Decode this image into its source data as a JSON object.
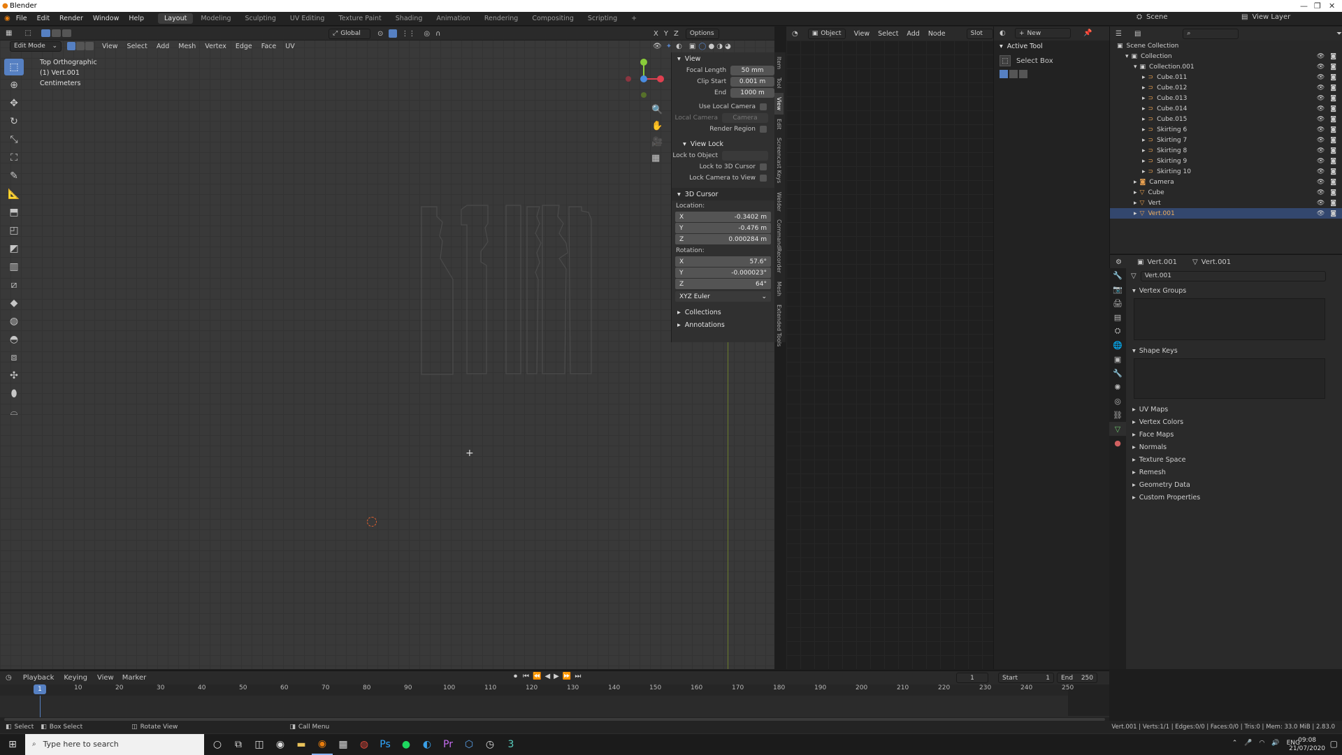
{
  "window": {
    "title": "Blender"
  },
  "menu": [
    "File",
    "Edit",
    "Render",
    "Window",
    "Help"
  ],
  "workspaces": [
    "Layout",
    "Modeling",
    "Sculpting",
    "UV Editing",
    "Texture Paint",
    "Shading",
    "Animation",
    "Rendering",
    "Compositing",
    "Scripting",
    "+"
  ],
  "active_workspace": "Layout",
  "scene": {
    "name": "Scene",
    "view_layer": "View Layer"
  },
  "viewport": {
    "mode": "Edit Mode",
    "menus": [
      "View",
      "Select",
      "Add",
      "Mesh",
      "Vertex",
      "Edge",
      "Face",
      "UV"
    ],
    "orientation": "Global",
    "options": "Options",
    "info": [
      "Top Orthographic",
      "(1) Vert.001",
      "Centimeters"
    ]
  },
  "npanel": {
    "view_title": "View",
    "focal_length": {
      "label": "Focal Length",
      "value": "50 mm"
    },
    "clip_start": {
      "label": "Clip Start",
      "value": "0.001 m"
    },
    "clip_end": {
      "label": "End",
      "value": "1000 m"
    },
    "use_local_camera": "Use Local Camera",
    "local_camera": "Local Camera",
    "camera_field": "Camera",
    "render_region": "Render Region",
    "view_lock_title": "View Lock",
    "lock_to_object": "Lock to Object",
    "lock_to_3d_cursor": "Lock to 3D Cursor",
    "lock_camera_to_view": "Lock Camera to View",
    "cursor_title": "3D Cursor",
    "location_label": "Location:",
    "location": [
      {
        "axis": "X",
        "value": "-0.3402 m"
      },
      {
        "axis": "Y",
        "value": "-0.476 m"
      },
      {
        "axis": "Z",
        "value": "0.000284 m"
      }
    ],
    "rotation_label": "Rotation:",
    "rotation": [
      {
        "axis": "X",
        "value": "57.6°"
      },
      {
        "axis": "Y",
        "value": "-0.000023°"
      },
      {
        "axis": "Z",
        "value": "64°"
      }
    ],
    "rotation_mode": "XYZ Euler",
    "collections": "Collections",
    "annotations": "Annotations",
    "tabs": [
      "Item",
      "Tool",
      "View",
      "Edit",
      "Screencast Keys",
      "Welder",
      "CommandRecorder",
      "Mesh",
      "Extended Tools"
    ]
  },
  "node_editor": {
    "object": "Object",
    "menus": [
      "View",
      "Select",
      "Add",
      "Node"
    ],
    "slot": "Slot",
    "new": "New"
  },
  "active_tool": {
    "title": "Active Tool",
    "name": "Select Box"
  },
  "outliner": {
    "root": "Scene Collection",
    "collection": "Collection",
    "collection_001": "Collection.001",
    "items": [
      "Cube.011",
      "Cube.012",
      "Cube.013",
      "Cube.014",
      "Cube.015",
      "Skirting 6",
      "Skirting 7",
      "Skirting 8",
      "Skirting 9",
      "Skirting 10"
    ],
    "top_items": [
      "Camera",
      "Cube",
      "Vert",
      "Vert.001"
    ]
  },
  "properties": {
    "object": "Vert.001",
    "mesh": "Vert.001",
    "mesh_field": "Vert.001",
    "sections_open": [
      "Vertex Groups",
      "Shape Keys"
    ],
    "sections": [
      "UV Maps",
      "Vertex Colors",
      "Face Maps",
      "Normals",
      "Texture Space",
      "Remesh",
      "Geometry Data",
      "Custom Properties"
    ]
  },
  "timeline": {
    "menus": [
      "Playback",
      "Keying",
      "View",
      "Marker"
    ],
    "current_frame": "1",
    "start_label": "Start",
    "start": "1",
    "end_label": "End",
    "end": "250",
    "ticks": [
      "1",
      "10",
      "20",
      "30",
      "40",
      "50",
      "60",
      "70",
      "80",
      "90",
      "100",
      "110",
      "120",
      "130",
      "140",
      "150",
      "160",
      "170",
      "180",
      "190",
      "200",
      "210",
      "220",
      "230",
      "240",
      "250"
    ]
  },
  "status": {
    "items": [
      "Select",
      "Box Select",
      "Rotate View",
      "Call Menu"
    ],
    "stats": "Vert.001 | Verts:1/1 | Edges:0/0 | Faces:0/0 | Tris:0 | Mem: 33.0 MiB | 2.83.0"
  },
  "taskbar": {
    "search_placeholder": "Type here to search",
    "lang": "ENG",
    "time": "09:08",
    "date": "21/07/2020"
  },
  "colors": {
    "accent": "#5680c2",
    "selection": "#33476e",
    "x_axis": "#e04050",
    "y_axis": "#8acc3a",
    "z_axis": "#4a8ce0"
  }
}
